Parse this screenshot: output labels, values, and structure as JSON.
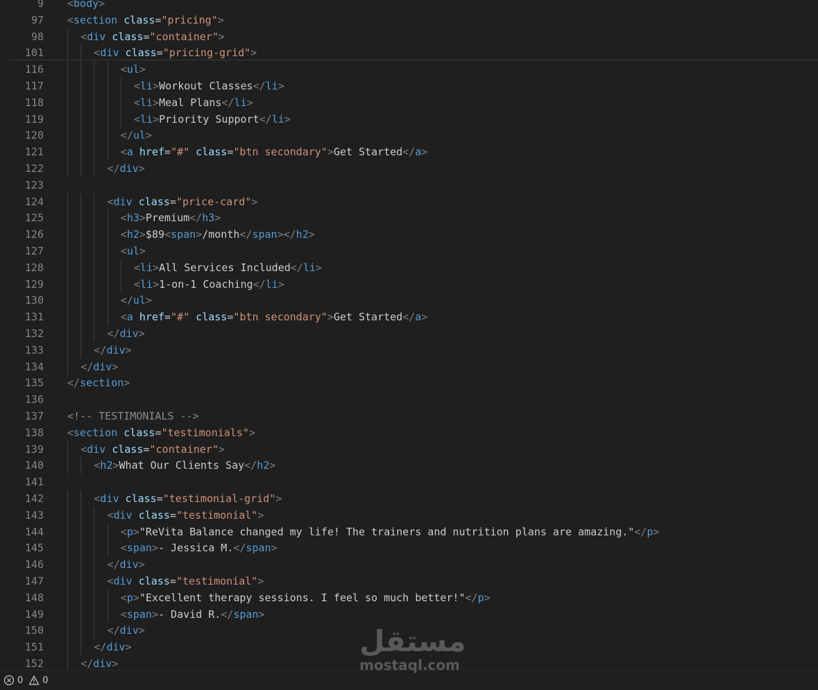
{
  "editor": {
    "sticky_lines": [
      {
        "number": "9",
        "indent": 0,
        "tokens": [
          [
            "br",
            "<"
          ],
          [
            "tag",
            "body"
          ],
          [
            "br",
            ">"
          ]
        ]
      },
      {
        "number": "97",
        "indent": 0,
        "tokens": [
          [
            "br",
            "<"
          ],
          [
            "tag",
            "section"
          ],
          [
            "txt",
            " "
          ],
          [
            "attr",
            "class"
          ],
          [
            "txt",
            "="
          ],
          [
            "str",
            "\"pricing\""
          ],
          [
            "br",
            ">"
          ]
        ]
      },
      {
        "number": "98",
        "indent": 1,
        "tokens": [
          [
            "br",
            "<"
          ],
          [
            "tag",
            "div"
          ],
          [
            "txt",
            " "
          ],
          [
            "attr",
            "class"
          ],
          [
            "txt",
            "="
          ],
          [
            "str",
            "\"container\""
          ],
          [
            "br",
            ">"
          ]
        ]
      },
      {
        "number": "101",
        "indent": 2,
        "tokens": [
          [
            "br",
            "<"
          ],
          [
            "tag",
            "div"
          ],
          [
            "txt",
            " "
          ],
          [
            "attr",
            "class"
          ],
          [
            "txt",
            "="
          ],
          [
            "str",
            "\"pricing-grid\""
          ],
          [
            "br",
            ">"
          ]
        ]
      }
    ],
    "lines": [
      {
        "number": "116",
        "indent": 4,
        "tokens": [
          [
            "br",
            "<"
          ],
          [
            "tag",
            "ul"
          ],
          [
            "br",
            ">"
          ]
        ]
      },
      {
        "number": "117",
        "indent": 5,
        "tokens": [
          [
            "br",
            "<"
          ],
          [
            "tag",
            "li"
          ],
          [
            "br",
            ">"
          ],
          [
            "txt",
            "Workout Classes"
          ],
          [
            "br",
            "</"
          ],
          [
            "tag",
            "li"
          ],
          [
            "br",
            ">"
          ]
        ]
      },
      {
        "number": "118",
        "indent": 5,
        "tokens": [
          [
            "br",
            "<"
          ],
          [
            "tag",
            "li"
          ],
          [
            "br",
            ">"
          ],
          [
            "txt",
            "Meal Plans"
          ],
          [
            "br",
            "</"
          ],
          [
            "tag",
            "li"
          ],
          [
            "br",
            ">"
          ]
        ]
      },
      {
        "number": "119",
        "indent": 5,
        "tokens": [
          [
            "br",
            "<"
          ],
          [
            "tag",
            "li"
          ],
          [
            "br",
            ">"
          ],
          [
            "txt",
            "Priority Support"
          ],
          [
            "br",
            "</"
          ],
          [
            "tag",
            "li"
          ],
          [
            "br",
            ">"
          ]
        ]
      },
      {
        "number": "120",
        "indent": 4,
        "tokens": [
          [
            "br",
            "</"
          ],
          [
            "tag",
            "ul"
          ],
          [
            "br",
            ">"
          ]
        ]
      },
      {
        "number": "121",
        "indent": 4,
        "tokens": [
          [
            "br",
            "<"
          ],
          [
            "tag",
            "a"
          ],
          [
            "txt",
            " "
          ],
          [
            "attr",
            "href"
          ],
          [
            "txt",
            "="
          ],
          [
            "str",
            "\"#\""
          ],
          [
            "txt",
            " "
          ],
          [
            "attr",
            "class"
          ],
          [
            "txt",
            "="
          ],
          [
            "str",
            "\"btn secondary\""
          ],
          [
            "br",
            ">"
          ],
          [
            "txt",
            "Get Started"
          ],
          [
            "br",
            "</"
          ],
          [
            "tag",
            "a"
          ],
          [
            "br",
            ">"
          ]
        ]
      },
      {
        "number": "122",
        "indent": 3,
        "tokens": [
          [
            "br",
            "</"
          ],
          [
            "tag",
            "div"
          ],
          [
            "br",
            ">"
          ]
        ]
      },
      {
        "number": "123",
        "indent": 0,
        "tokens": []
      },
      {
        "number": "124",
        "indent": 3,
        "tokens": [
          [
            "br",
            "<"
          ],
          [
            "tag",
            "div"
          ],
          [
            "txt",
            " "
          ],
          [
            "attr",
            "class"
          ],
          [
            "txt",
            "="
          ],
          [
            "str",
            "\"price-card\""
          ],
          [
            "br",
            ">"
          ]
        ]
      },
      {
        "number": "125",
        "indent": 4,
        "tokens": [
          [
            "br",
            "<"
          ],
          [
            "tag",
            "h3"
          ],
          [
            "br",
            ">"
          ],
          [
            "txt",
            "Premium"
          ],
          [
            "br",
            "</"
          ],
          [
            "tag",
            "h3"
          ],
          [
            "br",
            ">"
          ]
        ]
      },
      {
        "number": "126",
        "indent": 4,
        "tokens": [
          [
            "br",
            "<"
          ],
          [
            "tag",
            "h2"
          ],
          [
            "br",
            ">"
          ],
          [
            "txt",
            "$89"
          ],
          [
            "br",
            "<"
          ],
          [
            "tag",
            "span"
          ],
          [
            "br",
            ">"
          ],
          [
            "txt",
            "/month"
          ],
          [
            "br",
            "</"
          ],
          [
            "tag",
            "span"
          ],
          [
            "br",
            "></"
          ],
          [
            "tag",
            "h2"
          ],
          [
            "br",
            ">"
          ]
        ]
      },
      {
        "number": "127",
        "indent": 4,
        "tokens": [
          [
            "br",
            "<"
          ],
          [
            "tag",
            "ul"
          ],
          [
            "br",
            ">"
          ]
        ]
      },
      {
        "number": "128",
        "indent": 5,
        "tokens": [
          [
            "br",
            "<"
          ],
          [
            "tag",
            "li"
          ],
          [
            "br",
            ">"
          ],
          [
            "txt",
            "All Services Included"
          ],
          [
            "br",
            "</"
          ],
          [
            "tag",
            "li"
          ],
          [
            "br",
            ">"
          ]
        ]
      },
      {
        "number": "129",
        "indent": 5,
        "tokens": [
          [
            "br",
            "<"
          ],
          [
            "tag",
            "li"
          ],
          [
            "br",
            ">"
          ],
          [
            "txt",
            "1-on-1 Coaching"
          ],
          [
            "br",
            "</"
          ],
          [
            "tag",
            "li"
          ],
          [
            "br",
            ">"
          ]
        ]
      },
      {
        "number": "130",
        "indent": 4,
        "tokens": [
          [
            "br",
            "</"
          ],
          [
            "tag",
            "ul"
          ],
          [
            "br",
            ">"
          ]
        ]
      },
      {
        "number": "131",
        "indent": 4,
        "tokens": [
          [
            "br",
            "<"
          ],
          [
            "tag",
            "a"
          ],
          [
            "txt",
            " "
          ],
          [
            "attr",
            "href"
          ],
          [
            "txt",
            "="
          ],
          [
            "str",
            "\"#\""
          ],
          [
            "txt",
            " "
          ],
          [
            "attr",
            "class"
          ],
          [
            "txt",
            "="
          ],
          [
            "str",
            "\"btn secondary\""
          ],
          [
            "br",
            ">"
          ],
          [
            "txt",
            "Get Started"
          ],
          [
            "br",
            "</"
          ],
          [
            "tag",
            "a"
          ],
          [
            "br",
            ">"
          ]
        ]
      },
      {
        "number": "132",
        "indent": 3,
        "tokens": [
          [
            "br",
            "</"
          ],
          [
            "tag",
            "div"
          ],
          [
            "br",
            ">"
          ]
        ]
      },
      {
        "number": "133",
        "indent": 2,
        "tokens": [
          [
            "br",
            "</"
          ],
          [
            "tag",
            "div"
          ],
          [
            "br",
            ">"
          ]
        ]
      },
      {
        "number": "134",
        "indent": 1,
        "tokens": [
          [
            "br",
            "</"
          ],
          [
            "tag",
            "div"
          ],
          [
            "br",
            ">"
          ]
        ]
      },
      {
        "number": "135",
        "indent": 0,
        "tokens": [
          [
            "br",
            "</"
          ],
          [
            "tag",
            "section"
          ],
          [
            "br",
            ">"
          ]
        ]
      },
      {
        "number": "136",
        "indent": 0,
        "tokens": []
      },
      {
        "number": "137",
        "indent": 0,
        "tokens": [
          [
            "com",
            "<!-- TESTIMONIALS -->"
          ]
        ]
      },
      {
        "number": "138",
        "indent": 0,
        "tokens": [
          [
            "br",
            "<"
          ],
          [
            "tag",
            "section"
          ],
          [
            "txt",
            " "
          ],
          [
            "attr",
            "class"
          ],
          [
            "txt",
            "="
          ],
          [
            "str",
            "\"testimonials\""
          ],
          [
            "br",
            ">"
          ]
        ]
      },
      {
        "number": "139",
        "indent": 1,
        "tokens": [
          [
            "br",
            "<"
          ],
          [
            "tag",
            "div"
          ],
          [
            "txt",
            " "
          ],
          [
            "attr",
            "class"
          ],
          [
            "txt",
            "="
          ],
          [
            "str",
            "\"container\""
          ],
          [
            "br",
            ">"
          ]
        ]
      },
      {
        "number": "140",
        "indent": 2,
        "tokens": [
          [
            "br",
            "<"
          ],
          [
            "tag",
            "h2"
          ],
          [
            "br",
            ">"
          ],
          [
            "txt",
            "What Our Clients Say"
          ],
          [
            "br",
            "</"
          ],
          [
            "tag",
            "h2"
          ],
          [
            "br",
            ">"
          ]
        ]
      },
      {
        "number": "141",
        "indent": 0,
        "tokens": []
      },
      {
        "number": "142",
        "indent": 2,
        "tokens": [
          [
            "br",
            "<"
          ],
          [
            "tag",
            "div"
          ],
          [
            "txt",
            " "
          ],
          [
            "attr",
            "class"
          ],
          [
            "txt",
            "="
          ],
          [
            "str",
            "\"testimonial-grid\""
          ],
          [
            "br",
            ">"
          ]
        ]
      },
      {
        "number": "143",
        "indent": 3,
        "tokens": [
          [
            "br",
            "<"
          ],
          [
            "tag",
            "div"
          ],
          [
            "txt",
            " "
          ],
          [
            "attr",
            "class"
          ],
          [
            "txt",
            "="
          ],
          [
            "str",
            "\"testimonial\""
          ],
          [
            "br",
            ">"
          ]
        ]
      },
      {
        "number": "144",
        "indent": 4,
        "tokens": [
          [
            "br",
            "<"
          ],
          [
            "tag",
            "p"
          ],
          [
            "br",
            ">"
          ],
          [
            "txt",
            "\"ReVita Balance changed my life! The trainers and nutrition plans are amazing.\""
          ],
          [
            "br",
            "</"
          ],
          [
            "tag",
            "p"
          ],
          [
            "br",
            ">"
          ]
        ]
      },
      {
        "number": "145",
        "indent": 4,
        "tokens": [
          [
            "br",
            "<"
          ],
          [
            "tag",
            "span"
          ],
          [
            "br",
            ">"
          ],
          [
            "txt",
            "- Jessica M."
          ],
          [
            "br",
            "</"
          ],
          [
            "tag",
            "span"
          ],
          [
            "br",
            ">"
          ]
        ]
      },
      {
        "number": "146",
        "indent": 3,
        "tokens": [
          [
            "br",
            "</"
          ],
          [
            "tag",
            "div"
          ],
          [
            "br",
            ">"
          ]
        ]
      },
      {
        "number": "147",
        "indent": 3,
        "tokens": [
          [
            "br",
            "<"
          ],
          [
            "tag",
            "div"
          ],
          [
            "txt",
            " "
          ],
          [
            "attr",
            "class"
          ],
          [
            "txt",
            "="
          ],
          [
            "str",
            "\"testimonial\""
          ],
          [
            "br",
            ">"
          ]
        ]
      },
      {
        "number": "148",
        "indent": 4,
        "tokens": [
          [
            "br",
            "<"
          ],
          [
            "tag",
            "p"
          ],
          [
            "br",
            ">"
          ],
          [
            "txt",
            "\"Excellent therapy sessions. I feel so much better!\""
          ],
          [
            "br",
            "</"
          ],
          [
            "tag",
            "p"
          ],
          [
            "br",
            ">"
          ]
        ]
      },
      {
        "number": "149",
        "indent": 4,
        "tokens": [
          [
            "br",
            "<"
          ],
          [
            "tag",
            "span"
          ],
          [
            "br",
            ">"
          ],
          [
            "txt",
            "- David R."
          ],
          [
            "br",
            "</"
          ],
          [
            "tag",
            "span"
          ],
          [
            "br",
            ">"
          ]
        ]
      },
      {
        "number": "150",
        "indent": 3,
        "tokens": [
          [
            "br",
            "</"
          ],
          [
            "tag",
            "div"
          ],
          [
            "br",
            ">"
          ]
        ]
      },
      {
        "number": "151",
        "indent": 2,
        "tokens": [
          [
            "br",
            "</"
          ],
          [
            "tag",
            "div"
          ],
          [
            "br",
            ">"
          ]
        ]
      },
      {
        "number": "152",
        "indent": 1,
        "tokens": [
          [
            "br",
            "</"
          ],
          [
            "tag",
            "div"
          ],
          [
            "br",
            ">"
          ]
        ]
      }
    ]
  },
  "statusbar": {
    "errors_icon": "error-circle-icon",
    "errors_count": "0",
    "warnings_icon": "warning-triangle-icon",
    "warnings_count": "0"
  },
  "watermark": {
    "arabic_text": "مستقل",
    "latin_text": "mostaql.com"
  },
  "colors": {
    "background": "#1f1f1f",
    "line_number": "#858585",
    "tag_bracket": "#808080",
    "tag_name": "#569cd6",
    "attribute": "#9cdcfe",
    "string": "#ce9178",
    "text": "#cccccc",
    "comment": "#8b8b8b"
  }
}
